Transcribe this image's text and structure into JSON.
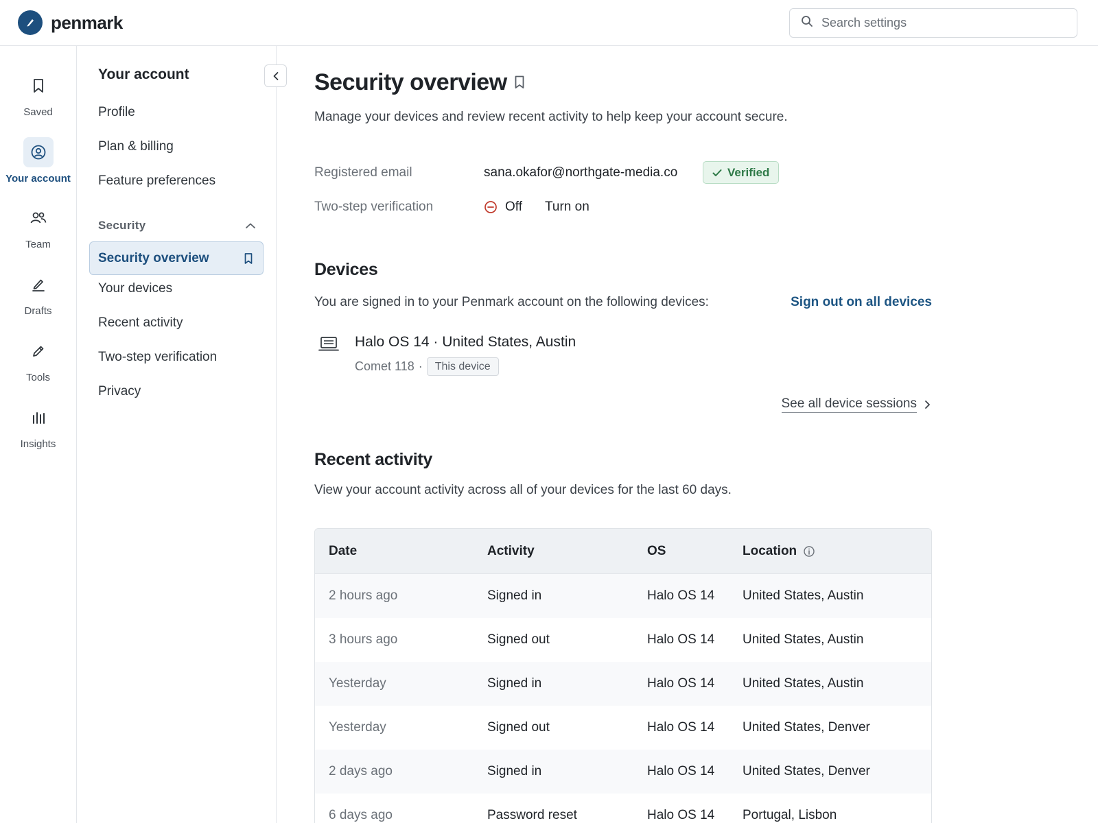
{
  "app": {
    "name": "penmark",
    "search_placeholder": "Search settings"
  },
  "rail": [
    {
      "label": "Saved",
      "icon": "bookmark-icon"
    },
    {
      "label": "Your account",
      "icon": "user-circle-icon",
      "active": true
    },
    {
      "label": "Team",
      "icon": "team-icon"
    },
    {
      "label": "Drafts",
      "icon": "pen-line-icon"
    },
    {
      "label": "Tools",
      "icon": "pencil-icon"
    },
    {
      "label": "Insights",
      "icon": "bar-chart-icon"
    }
  ],
  "section_nav": {
    "title": "Your account",
    "items": [
      "Profile",
      "Plan & billing",
      "Feature preferences"
    ],
    "group": {
      "label": "Security",
      "expanded": true,
      "active_item": "Security overview",
      "items": [
        "Your devices",
        "Recent activity",
        "Two-step verification",
        "Privacy"
      ]
    }
  },
  "main": {
    "title": "Security overview",
    "description": "Manage your devices and review recent activity to help keep your account secure.",
    "email_label": "Registered email",
    "email_value": "sana.okafor@northgate-media.co",
    "verified_label": "Verified",
    "twostep_label": "Two-step verification",
    "twostep_status": "Off",
    "twostep_action": "Turn on",
    "devices": {
      "heading": "Devices",
      "intro": "You are signed in to your Penmark account on the following devices:",
      "sign_out_all": "Sign out on all devices",
      "device_name": "Halo OS 14 · United States, Austin",
      "device_browser": "Comet 118",
      "device_separator": "·",
      "this_device_badge": "This device",
      "see_all": "See all device sessions"
    },
    "activity": {
      "heading": "Recent activity",
      "intro": "View your account activity across all of your devices for the last 60 days.",
      "columns": [
        "Date",
        "Activity",
        "OS",
        "Location"
      ],
      "rows": [
        [
          "2 hours ago",
          "Signed in",
          "Halo OS 14",
          "United States, Austin"
        ],
        [
          "3 hours ago",
          "Signed out",
          "Halo OS 14",
          "United States, Austin"
        ],
        [
          "Yesterday",
          "Signed in",
          "Halo OS 14",
          "United States, Austin"
        ],
        [
          "Yesterday",
          "Signed out",
          "Halo OS 14",
          "United States, Denver"
        ],
        [
          "2 days ago",
          "Signed in",
          "Halo OS 14",
          "United States, Denver"
        ],
        [
          "6 days ago",
          "Password reset",
          "Halo OS 14",
          "Portugal, Lisbon"
        ]
      ]
    }
  },
  "colors": {
    "brand": "#1d4f7e",
    "link": "#1d5583",
    "success": "#2f7a48",
    "danger": "#c0392b"
  }
}
